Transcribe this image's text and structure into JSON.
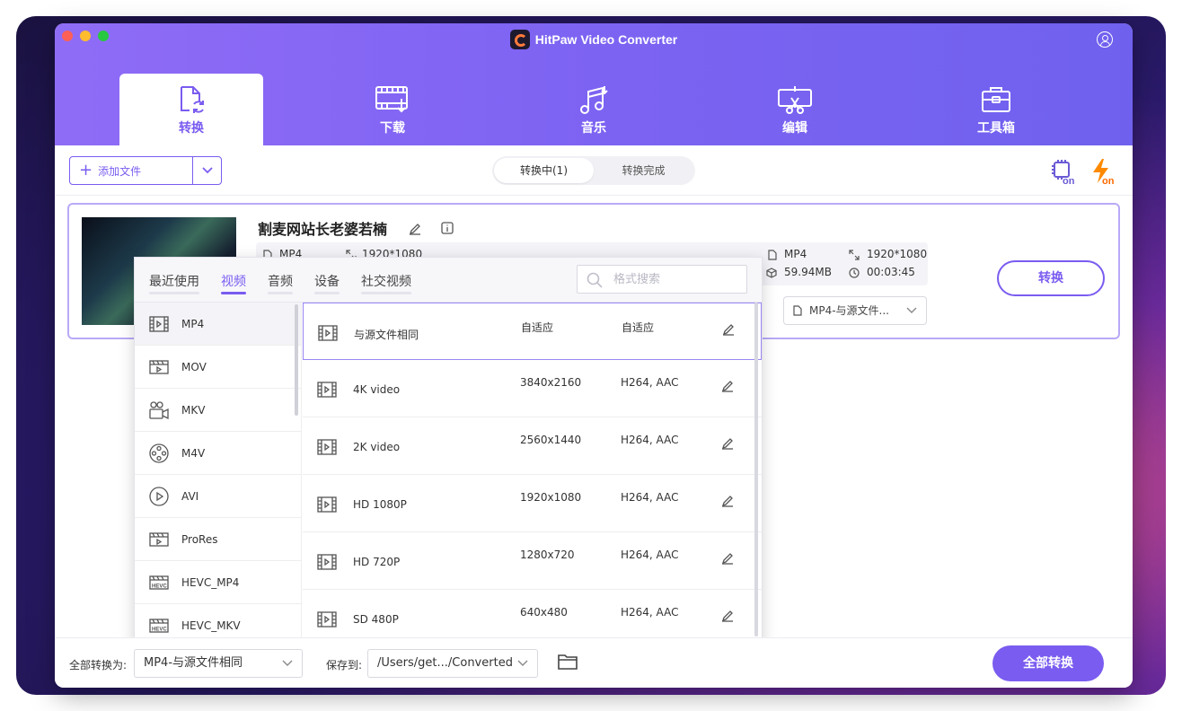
{
  "app": {
    "title": "HitPaw Video Converter"
  },
  "nav": [
    {
      "id": "convert",
      "label": "转换",
      "active": true
    },
    {
      "id": "download",
      "label": "下载"
    },
    {
      "id": "music",
      "label": "音乐"
    },
    {
      "id": "edit",
      "label": "编辑"
    },
    {
      "id": "toolbox",
      "label": "工具箱"
    }
  ],
  "toolbar": {
    "add_label": "添加文件",
    "seg": [
      {
        "label": "转换中(1)",
        "active": true
      },
      {
        "label": "转换完成"
      }
    ]
  },
  "file": {
    "title": "割麦网站长老婆若楠",
    "src_format": "MP4",
    "src_res": "1920*1080",
    "out_format": "MP4",
    "out_res": "1920*1080",
    "out_size": "59.94MB",
    "out_duration": "00:03:45",
    "output_select": "MP4-与源文件...",
    "convert_label": "转换"
  },
  "popup": {
    "tabs": [
      {
        "label": "最近使用"
      },
      {
        "label": "视频",
        "active": true
      },
      {
        "label": "音频"
      },
      {
        "label": "设备"
      },
      {
        "label": "社交视频"
      }
    ],
    "search_placeholder": "格式搜索",
    "formats": [
      {
        "label": "MP4",
        "icon": "film-icon",
        "active": true
      },
      {
        "label": "MOV",
        "icon": "mov-icon"
      },
      {
        "label": "MKV",
        "icon": "camera-icon"
      },
      {
        "label": "M4V",
        "icon": "reel-icon"
      },
      {
        "label": "AVI",
        "icon": "play-circle-icon"
      },
      {
        "label": "ProRes",
        "icon": "mov-icon"
      },
      {
        "label": "HEVC_MP4",
        "icon": "hevc-icon"
      },
      {
        "label": "HEVC_MKV",
        "icon": "hevc-icon"
      }
    ],
    "presets": [
      {
        "name": "与源文件相同",
        "res": "自适应",
        "codec": "自适应",
        "active": true
      },
      {
        "name": "4K video",
        "res": "3840x2160",
        "codec": "H264, AAC"
      },
      {
        "name": "2K video",
        "res": "2560x1440",
        "codec": "H264, AAC"
      },
      {
        "name": "HD 1080P",
        "res": "1920x1080",
        "codec": "H264, AAC"
      },
      {
        "name": "HD 720P",
        "res": "1280x720",
        "codec": "H264, AAC"
      },
      {
        "name": "SD 480P",
        "res": "640x480",
        "codec": "H264, AAC"
      }
    ]
  },
  "bottom": {
    "convert_all_to_label": "全部转换为:",
    "convert_all_to_value": "MP4-与源文件相同",
    "save_to_label": "保存到:",
    "save_to_value": "/Users/get.../Converted",
    "convert_all_button": "全部转换"
  },
  "colors": {
    "accent": "#7a5cf0",
    "header_start": "#8f6cf6",
    "header_end": "#6f61ee"
  }
}
